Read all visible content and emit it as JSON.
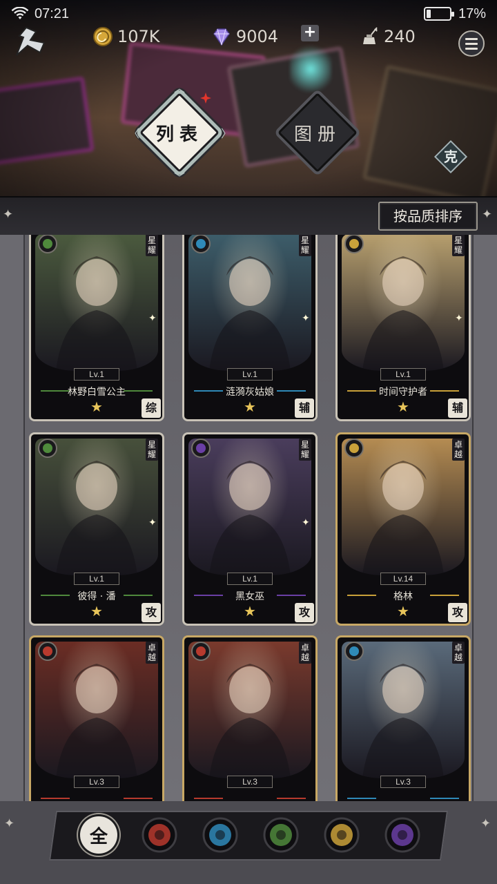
{
  "status": {
    "time": "07:21",
    "battery": "17%"
  },
  "resources": {
    "gold": "107K",
    "gems": "9004",
    "ink": "240"
  },
  "tabs": {
    "list": "列表",
    "album": "图册"
  },
  "restrain_label": "克",
  "sort_label": "按品质排序",
  "filters": [
    {
      "key": "all",
      "label": "全",
      "color": "#e8e4dc"
    },
    {
      "key": "fire",
      "color": "#b73a2e"
    },
    {
      "key": "water",
      "color": "#2f8ab8"
    },
    {
      "key": "nature",
      "color": "#4f8a3c"
    },
    {
      "key": "light",
      "color": "#c9a13a"
    },
    {
      "key": "dark",
      "color": "#6a3fa5"
    }
  ],
  "cards": [
    {
      "name": "林野白雪公主",
      "level": "Lv.1",
      "rarity": "星耀",
      "role": "综",
      "element": "nature",
      "frame": "silver",
      "bg": "#4b5a3e"
    },
    {
      "name": "涟漪灰姑娘",
      "level": "Lv.1",
      "rarity": "星耀",
      "role": "辅",
      "element": "water",
      "frame": "silver",
      "bg": "#3d5d6a"
    },
    {
      "name": "时间守护者",
      "level": "Lv.1",
      "rarity": "星耀",
      "role": "辅",
      "element": "light",
      "frame": "silver",
      "bg": "#b79f6e"
    },
    {
      "name": "彼得 · 潘",
      "level": "Lv.1",
      "rarity": "星耀",
      "role": "攻",
      "element": "nature",
      "frame": "silver",
      "bg": "#47503b"
    },
    {
      "name": "黑女巫",
      "level": "Lv.1",
      "rarity": "星耀",
      "role": "攻",
      "element": "dark",
      "frame": "silver",
      "bg": "#4a3d5c"
    },
    {
      "name": "格林",
      "level": "Lv.14",
      "rarity": "卓越",
      "role": "攻",
      "element": "light",
      "frame": "gold",
      "bg": "#b58c52"
    },
    {
      "name": "",
      "level": "Lv.3",
      "rarity": "卓越",
      "role": "",
      "element": "fire",
      "frame": "gold",
      "bg": "#6b2d24"
    },
    {
      "name": "",
      "level": "Lv.3",
      "rarity": "卓越",
      "role": "",
      "element": "fire",
      "frame": "gold",
      "bg": "#7a3a2d"
    },
    {
      "name": "",
      "level": "Lv.3",
      "rarity": "卓越",
      "role": "",
      "element": "water",
      "frame": "gold",
      "bg": "#5a6a7a"
    }
  ]
}
